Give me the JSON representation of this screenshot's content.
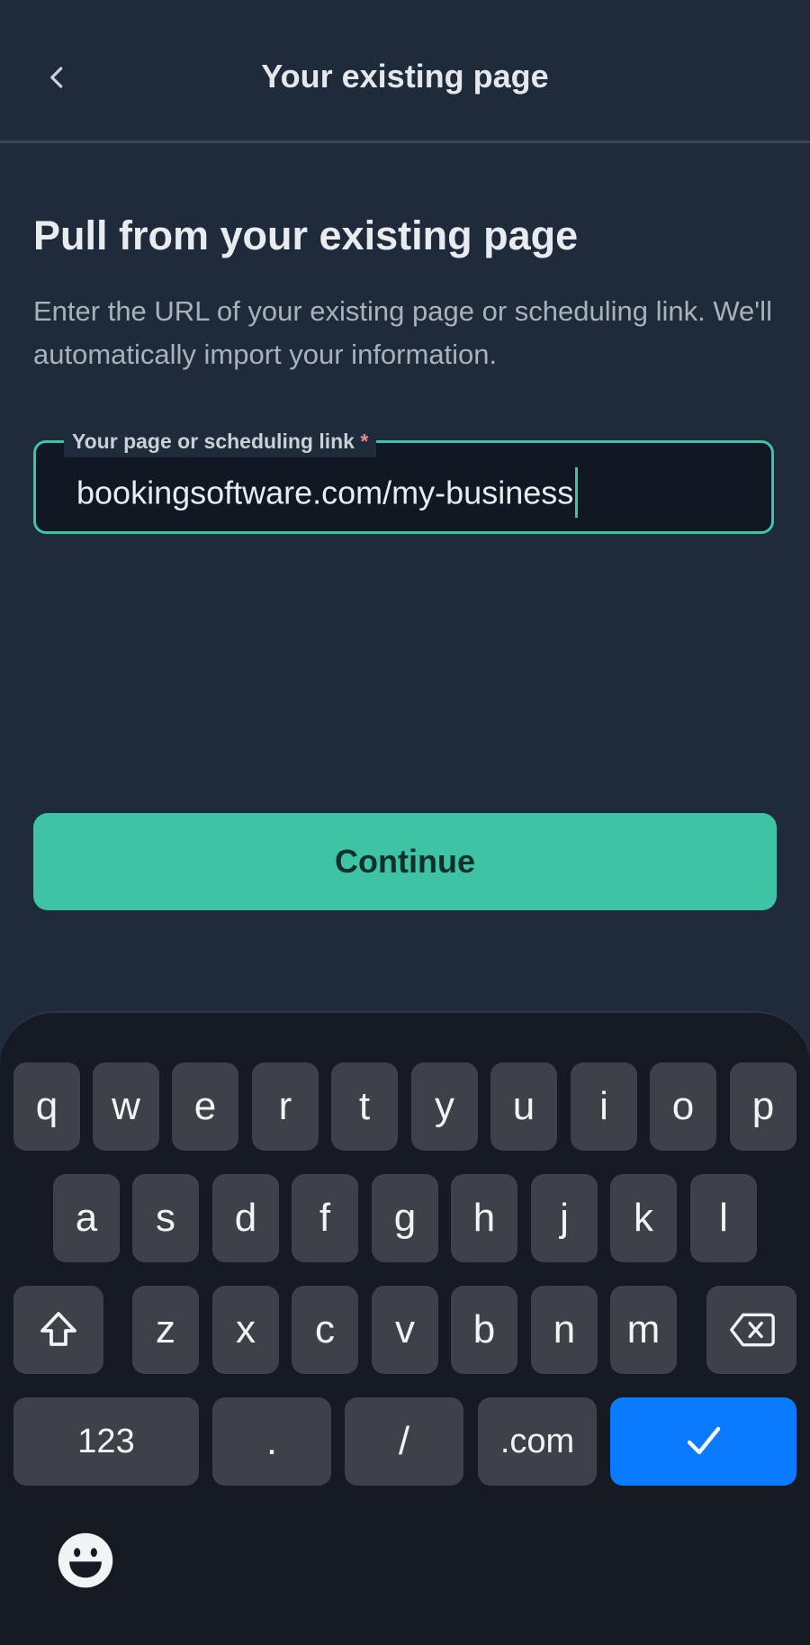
{
  "header": {
    "title": "Your existing page",
    "back_icon": "chevron-left-icon"
  },
  "main": {
    "title": "Pull from your existing page",
    "description": "Enter the URL of your existing page or scheduling link. We'll automatically import your information.",
    "field": {
      "label": "Your page or scheduling link",
      "required_mark": "*",
      "value": "bookingsoftware.com/my-business"
    },
    "continue_label": "Continue"
  },
  "keyboard": {
    "row1": [
      "q",
      "w",
      "e",
      "r",
      "t",
      "y",
      "u",
      "i",
      "o",
      "p"
    ],
    "row2": [
      "a",
      "s",
      "d",
      "f",
      "g",
      "h",
      "j",
      "k",
      "l"
    ],
    "row3": [
      "z",
      "x",
      "c",
      "v",
      "b",
      "n",
      "m"
    ],
    "row4": {
      "numbers": "123",
      "dot": ".",
      "slash": "/",
      "dotcom": ".com"
    },
    "icons": {
      "shift": "shift-icon",
      "backspace": "backspace-icon",
      "enter": "checkmark-icon",
      "emoji": "emoji-icon"
    }
  },
  "colors": {
    "background": "#1f2a3a",
    "accent": "#3ec3a4",
    "enter_key": "#0a7bff",
    "keyboard_bg": "#161b23",
    "key_bg": "#3e4147"
  }
}
